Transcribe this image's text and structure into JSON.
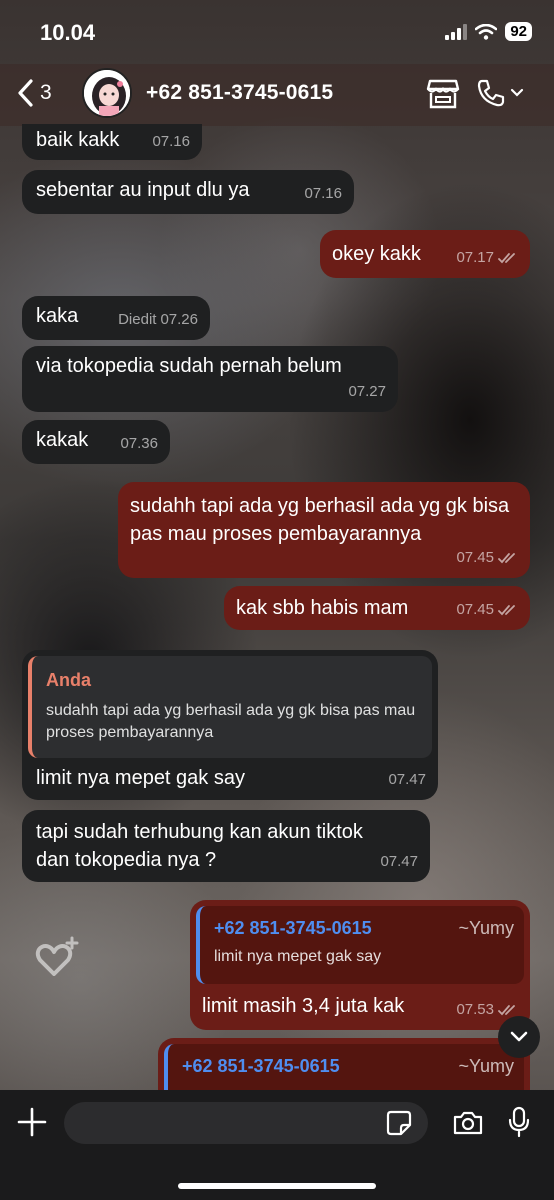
{
  "status_bar": {
    "time": "10.04",
    "battery": "92"
  },
  "header": {
    "back_count": "3",
    "contact": "+62 851-3745-0615"
  },
  "messages": [
    {
      "text": "baik kakk",
      "time": "07.16"
    },
    {
      "text": "sebentar au input dlu ya",
      "time": "07.16"
    },
    {
      "text": "okey kakk",
      "time": "07.17"
    },
    {
      "text": "kaka",
      "edited": "Diedit",
      "time": "07.26"
    },
    {
      "text": "via tokopedia sudah pernah belum",
      "time": "07.27"
    },
    {
      "text": "kakak",
      "time": "07.36"
    },
    {
      "text": "sudahh tapi ada yg berhasil ada yg gk bisa pas mau proses pembayarannya",
      "time": "07.45"
    },
    {
      "text": "kak sbb habis mam",
      "time": "07.45"
    },
    {
      "quote_name": "Anda",
      "quote_text": "sudahh tapi ada yg berhasil ada yg gk bisa pas mau proses pembayarannya",
      "text": "limit nya mepet gak say",
      "time": "07.47"
    },
    {
      "text": "tapi sudah terhubung kan akun tiktok dan tokopedia nya ?",
      "time": "07.47"
    },
    {
      "quote_name": "+62 851-3745-0615",
      "quote_sender": "~Yumy",
      "quote_text": "limit nya mepet gak say",
      "text": "limit masih 3,4 juta kak",
      "time": "07.53"
    },
    {
      "quote_name": "+62 851-3745-0615",
      "quote_sender": "~Yumy"
    }
  ],
  "input": {
    "placeholder": ""
  },
  "colors": {
    "incoming": "#1f2021",
    "outgoing": "#6b1d17",
    "quote_accent_in": "#e8806a",
    "quote_accent_out": "#4f8ef0"
  },
  "icons": [
    "back-chevron-icon",
    "store-icon",
    "phone-icon",
    "chevron-down-icon",
    "plus-icon",
    "sticker-icon",
    "camera-icon",
    "mic-icon"
  ]
}
